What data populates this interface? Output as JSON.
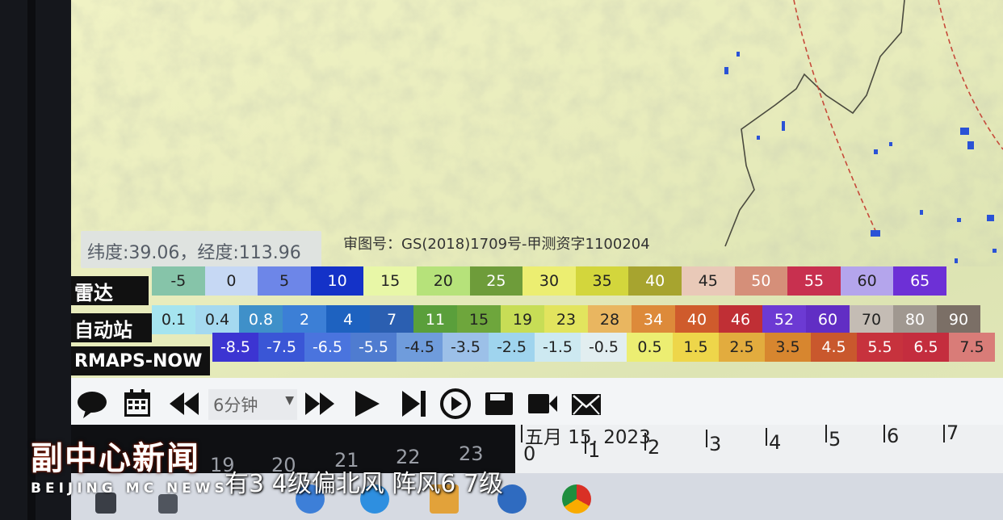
{
  "coords": {
    "text": "纬度:39.06，经度:113.96"
  },
  "approval": {
    "text": "审图号：GS(2018)1709号-甲测资字1100204"
  },
  "legend": {
    "radar": {
      "label": "雷达",
      "values": [
        "-5",
        "0",
        "5",
        "10",
        "15",
        "20",
        "25",
        "30",
        "35",
        "40",
        "45",
        "50",
        "55",
        "60",
        "65"
      ],
      "colors": [
        "#86c4a9",
        "#c6d8f4",
        "#6d86e8",
        "#1432c8",
        "#e8f7a7",
        "#b6e27a",
        "#6e9c3a",
        "#ecee71",
        "#d3d63c",
        "#a7a42f",
        "#e9c9b8",
        "#d58f79",
        "#c8304f",
        "#b4a5ec",
        "#6d30d6"
      ]
    },
    "station": {
      "label": "自动站",
      "values": [
        "0.1",
        "0.4",
        "0.8",
        "2",
        "4",
        "7",
        "11",
        "15",
        "19",
        "23",
        "28",
        "34",
        "40",
        "46",
        "52",
        "60",
        "70",
        "80",
        "90"
      ],
      "colors": [
        "#a5e4ef",
        "#a5d9f0",
        "#3f90c9",
        "#3c7fd6",
        "#1e62c0",
        "#2b5fb1",
        "#5a9f3b",
        "#6ea63c",
        "#c7dd56",
        "#e2e45e",
        "#e9b660",
        "#dd8a3a",
        "#cf5b2c",
        "#c02f35",
        "#6c3ad3",
        "#612ec4",
        "#c4bcb4",
        "#a09890",
        "#7b6f66"
      ]
    },
    "rmaps": {
      "label": "RMAPS-NOW",
      "values": [
        "-8.5",
        "-7.5",
        "-6.5",
        "-5.5",
        "-4.5",
        "-3.5",
        "-2.5",
        "-1.5",
        "-0.5",
        "0.5",
        "1.5",
        "2.5",
        "3.5",
        "4.5",
        "5.5",
        "6.5",
        "7.5"
      ],
      "colors": [
        "#3c34d2",
        "#3a56d6",
        "#4a74de",
        "#4f7cd0",
        "#6f9cdc",
        "#9cc0e8",
        "#9fd4ee",
        "#cde9f1",
        "#e2eef0",
        "#ecee72",
        "#eed64a",
        "#e2ac3e",
        "#d7862f",
        "#c9582d",
        "#c7323d",
        "#c42d3e",
        "#d97c78"
      ]
    }
  },
  "toolbar": {
    "interval": "6分钟",
    "icons": [
      "chat-icon",
      "calendar-icon",
      "rewind-icon",
      "fast-forward-icon",
      "play-icon",
      "skip-to-end-icon",
      "record-icon",
      "save-icon",
      "video-icon",
      "mail-icon"
    ]
  },
  "timeline": {
    "date": "五月 15, 2023",
    "hours_before": [
      "19",
      "20",
      "21",
      "22",
      "23"
    ],
    "hour_zero": "0",
    "hours_after": [
      "1",
      "2",
      "3",
      "4",
      "5",
      "6",
      "7"
    ]
  },
  "overlay": {
    "logo_cn": "副中心新闻",
    "logo_en": "BEIJING MC NEWS",
    "subtitle": "有3 4级偏北风 阵风6 7级"
  }
}
